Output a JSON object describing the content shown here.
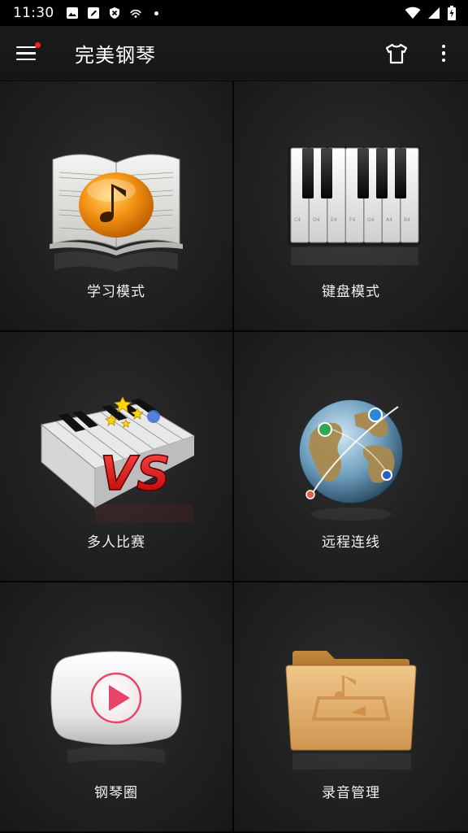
{
  "status_bar": {
    "time": "11:30",
    "left_icons": [
      "image-icon",
      "edit-icon",
      "shield-icon",
      "drone-icon",
      "dot-icon"
    ],
    "right_icons": [
      "wifi-icon",
      "signal-icon",
      "battery-icon"
    ]
  },
  "app_bar": {
    "title": "完美钢琴",
    "menu_icon": "hamburger-menu-icon",
    "theme_icon": "tshirt-icon",
    "more_icon": "more-vertical-icon"
  },
  "tiles": [
    {
      "label": "学习模式",
      "icon": "music-book-icon"
    },
    {
      "label": "键盘模式",
      "icon": "piano-keyboard-icon"
    },
    {
      "label": "多人比赛",
      "icon": "piano-vs-icon"
    },
    {
      "label": "远程连线",
      "icon": "globe-network-icon"
    },
    {
      "label": "钢琴圈",
      "icon": "play-video-icon"
    },
    {
      "label": "录音管理",
      "icon": "music-folder-icon"
    }
  ],
  "keyboard_key_labels": [
    "C4",
    "D4",
    "E4",
    "F4",
    "G4",
    "A4",
    "B4"
  ],
  "colors": {
    "accent_badge": "#ff1e1e",
    "background": "#1e1e1e",
    "play_button": "#e8446a",
    "folder": "#d9a55a",
    "orange_note": "#f08a10"
  }
}
